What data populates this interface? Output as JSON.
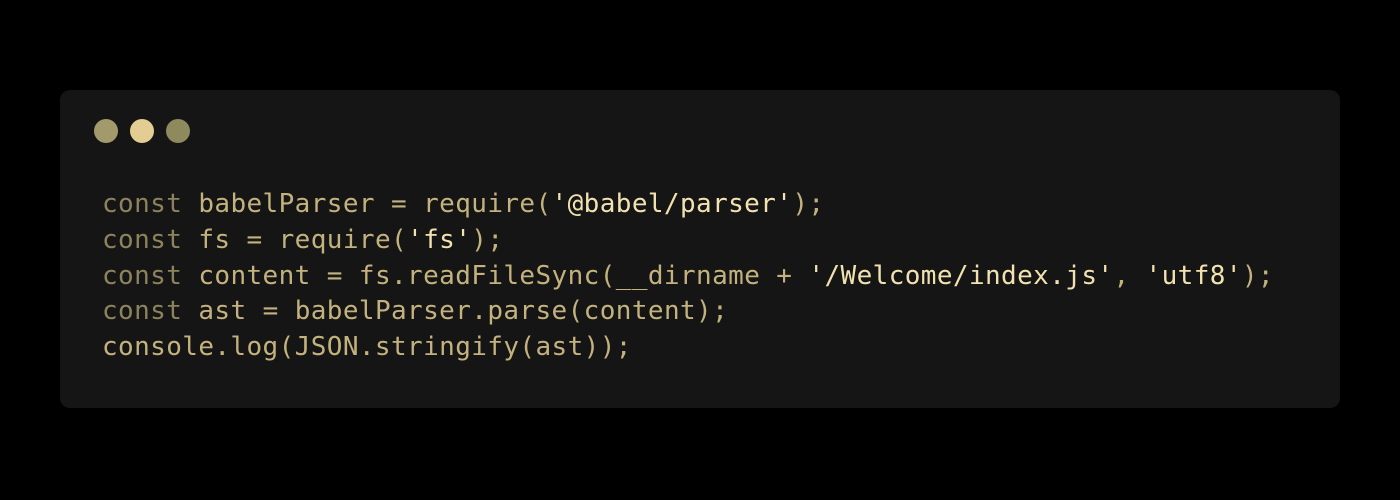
{
  "window": {
    "controls": [
      {
        "name": "window-dot-1",
        "color": "#a39a6b"
      },
      {
        "name": "window-dot-2",
        "color": "#e3cd92"
      },
      {
        "name": "window-dot-3",
        "color": "#8e8a5e"
      }
    ],
    "background": "#151515"
  },
  "colors": {
    "keyword": "#8c835d",
    "identifier": "#c3b27e",
    "string": "#f1e2b0"
  },
  "code": {
    "lines": [
      [
        {
          "t": "kw",
          "v": "const"
        },
        {
          "t": "op",
          "v": " "
        },
        {
          "t": "id",
          "v": "babelParser"
        },
        {
          "t": "op",
          "v": " = "
        },
        {
          "t": "id",
          "v": "require"
        },
        {
          "t": "op",
          "v": "("
        },
        {
          "t": "str",
          "v": "'@babel/parser'"
        },
        {
          "t": "op",
          "v": ");"
        }
      ],
      [
        {
          "t": "kw",
          "v": "const"
        },
        {
          "t": "op",
          "v": " "
        },
        {
          "t": "id",
          "v": "fs"
        },
        {
          "t": "op",
          "v": " = "
        },
        {
          "t": "id",
          "v": "require"
        },
        {
          "t": "op",
          "v": "("
        },
        {
          "t": "str",
          "v": "'fs'"
        },
        {
          "t": "op",
          "v": ");"
        }
      ],
      [
        {
          "t": "kw",
          "v": "const"
        },
        {
          "t": "op",
          "v": " "
        },
        {
          "t": "id",
          "v": "content"
        },
        {
          "t": "op",
          "v": " = "
        },
        {
          "t": "id",
          "v": "fs.readFileSync"
        },
        {
          "t": "op",
          "v": "("
        },
        {
          "t": "id",
          "v": "__dirname"
        },
        {
          "t": "op",
          "v": " + "
        },
        {
          "t": "str",
          "v": "'/Welcome/index.js'"
        },
        {
          "t": "op",
          "v": ", "
        },
        {
          "t": "str",
          "v": "'utf8'"
        },
        {
          "t": "op",
          "v": ");"
        }
      ],
      [
        {
          "t": "kw",
          "v": "const"
        },
        {
          "t": "op",
          "v": " "
        },
        {
          "t": "id",
          "v": "ast"
        },
        {
          "t": "op",
          "v": " = "
        },
        {
          "t": "id",
          "v": "babelParser.parse"
        },
        {
          "t": "op",
          "v": "("
        },
        {
          "t": "id",
          "v": "content"
        },
        {
          "t": "op",
          "v": ");"
        }
      ],
      [
        {
          "t": "id",
          "v": "console.log"
        },
        {
          "t": "op",
          "v": "("
        },
        {
          "t": "id",
          "v": "JSON.stringify"
        },
        {
          "t": "op",
          "v": "("
        },
        {
          "t": "id",
          "v": "ast"
        },
        {
          "t": "op",
          "v": "));"
        }
      ]
    ]
  }
}
